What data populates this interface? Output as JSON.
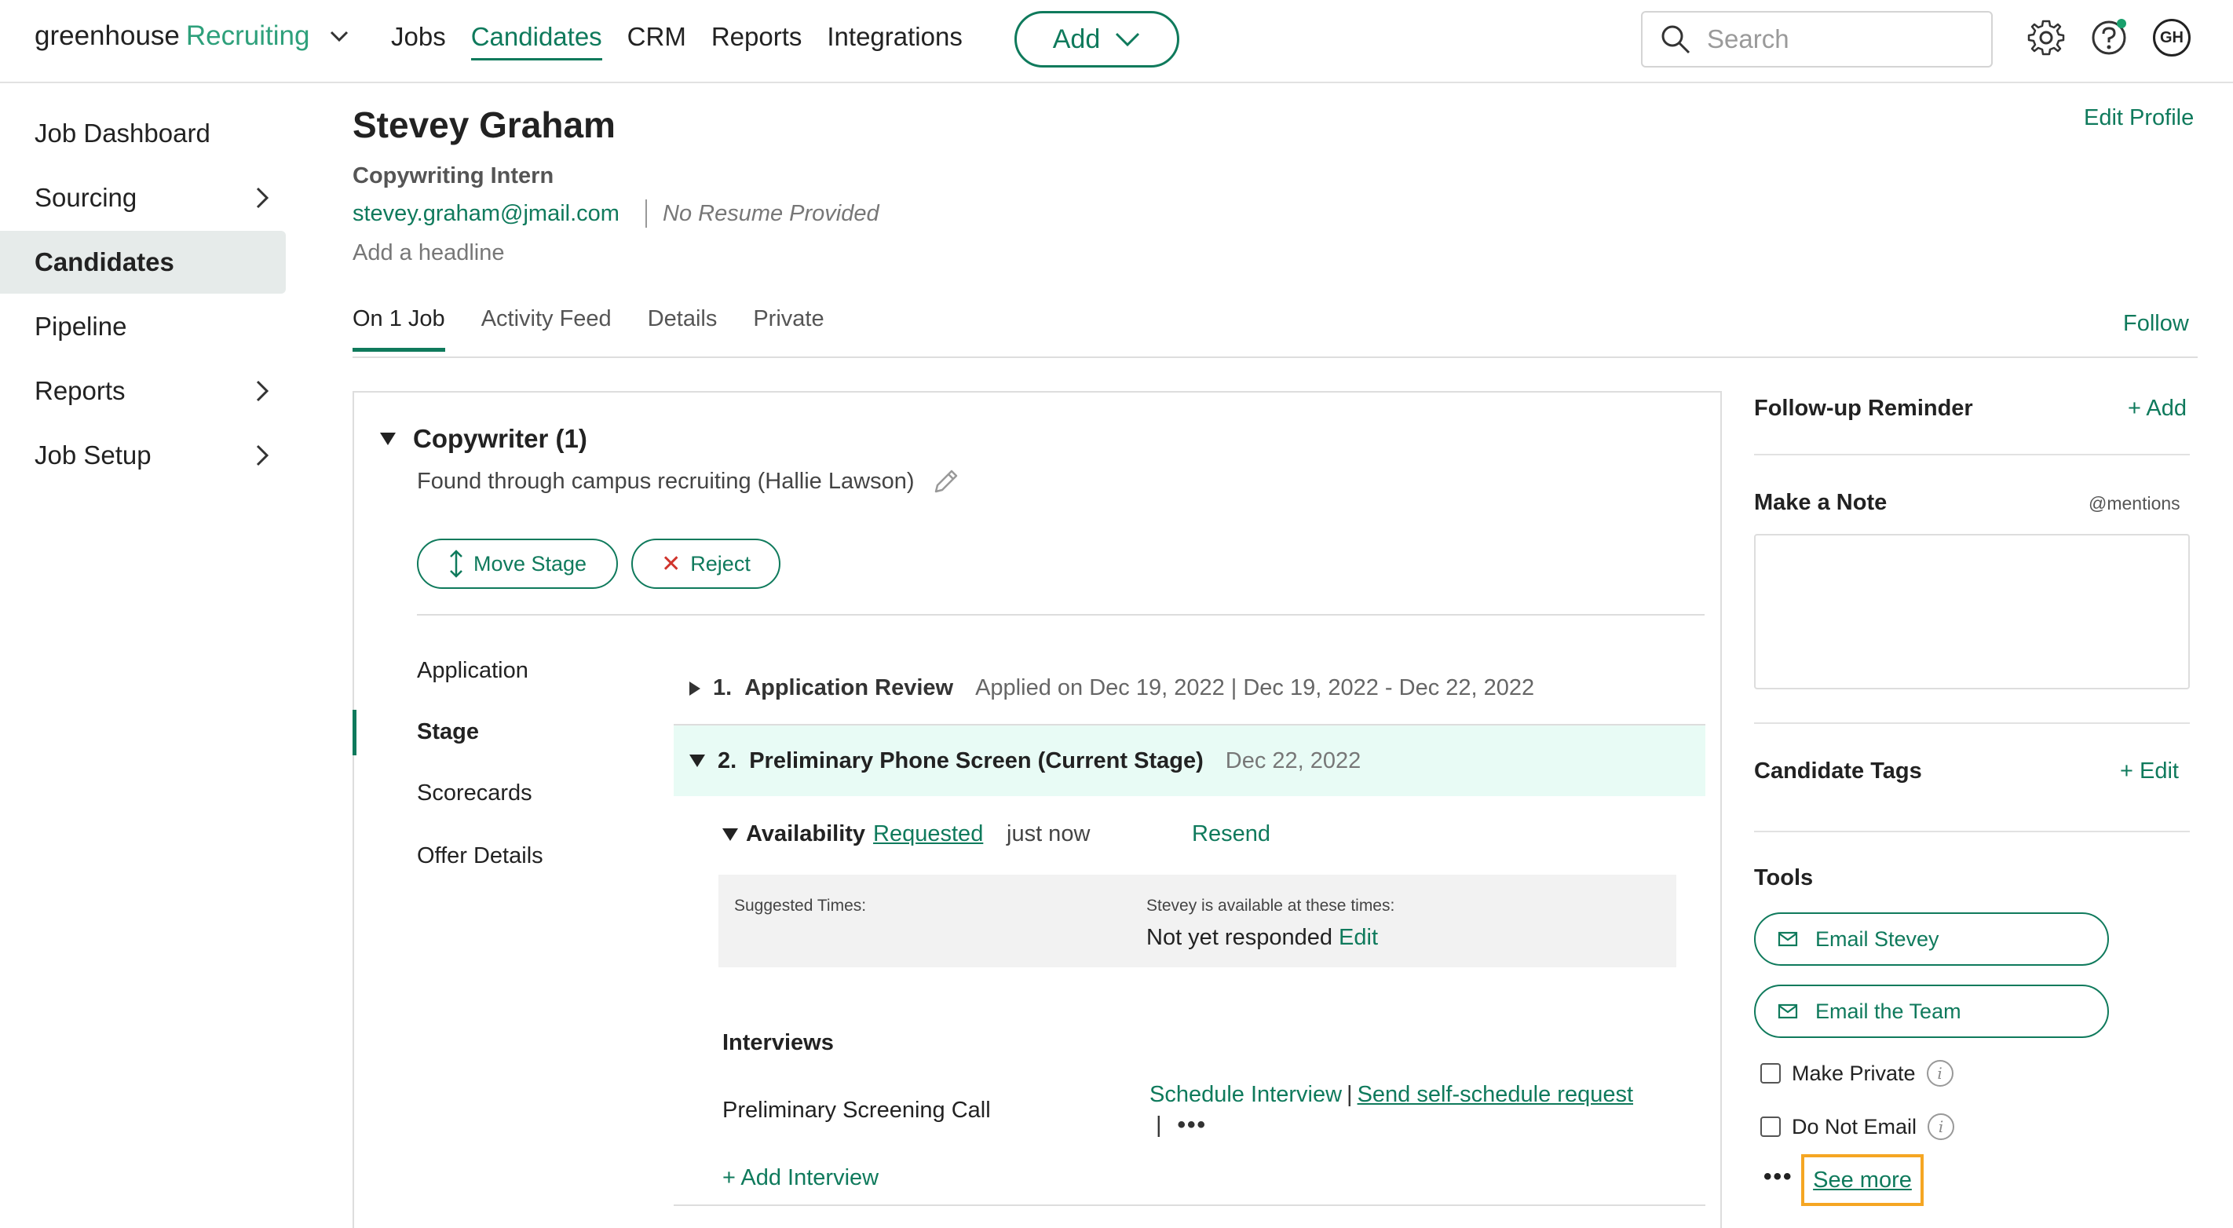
{
  "app": {
    "logo_main": "greenhouse",
    "logo_product": "Recruiting"
  },
  "nav": {
    "links": [
      "Jobs",
      "Candidates",
      "CRM",
      "Reports",
      "Integrations"
    ],
    "active": "Candidates",
    "add_label": "Add",
    "search_placeholder": "Search",
    "avatar_initials": "GH"
  },
  "sidebar": {
    "items": [
      {
        "label": "Job Dashboard",
        "has_chevron": false
      },
      {
        "label": "Sourcing",
        "has_chevron": true
      },
      {
        "label": "Candidates",
        "has_chevron": false,
        "active": true
      },
      {
        "label": "Pipeline",
        "has_chevron": false
      },
      {
        "label": "Reports",
        "has_chevron": true
      },
      {
        "label": "Job Setup",
        "has_chevron": true
      }
    ]
  },
  "candidate": {
    "name": "Stevey Graham",
    "title": "Copywriting Intern",
    "email": "stevey.graham@jmail.com",
    "resume_status": "No Resume Provided",
    "headline_placeholder": "Add a headline",
    "edit_profile_label": "Edit Profile"
  },
  "tabs": {
    "items": [
      "On 1 Job",
      "Activity Feed",
      "Details",
      "Private"
    ],
    "active": "On 1 Job",
    "follow_label": "Follow"
  },
  "job": {
    "title": "Copywriter (1)",
    "source": "Found through campus recruiting (Hallie Lawson)",
    "move_stage_label": "Move Stage",
    "reject_label": "Reject",
    "subnav": [
      "Application",
      "Stage",
      "Scorecards",
      "Offer Details"
    ],
    "subnav_active": "Stage",
    "stage1": {
      "number": "1.",
      "name": "Application Review",
      "meta": "Applied on Dec 19, 2022 | Dec 19, 2022 - Dec 22, 2022"
    },
    "stage2": {
      "number": "2.",
      "name": "Preliminary Phone Screen (Current Stage)",
      "meta": "Dec 22, 2022"
    },
    "availability": {
      "label": "Availability",
      "status": "Requested",
      "time": "just now",
      "resend_label": "Resend",
      "suggested_label": "Suggested Times:",
      "available_label": "Stevey is available at these times:",
      "response": "Not yet responded",
      "edit_label": "Edit"
    },
    "interviews": {
      "heading": "Interviews",
      "name": "Preliminary Screening Call",
      "schedule_label": "Schedule Interview",
      "separator": "|",
      "self_schedule_label": "Send self-schedule request",
      "more_label": "•••",
      "add_label": "+ Add Interview"
    }
  },
  "right_panel": {
    "followup_heading": "Follow-up Reminder",
    "followup_add": "+ Add",
    "note_heading": "Make a Note",
    "note_mentions": "@mentions",
    "tags_heading": "Candidate Tags",
    "tags_edit": "+ Edit",
    "tools_heading": "Tools",
    "email_candidate": "Email Stevey",
    "email_team": "Email the Team",
    "make_private": "Make Private",
    "do_not_email": "Do Not Email",
    "info_glyph": "i",
    "more_dots": "•••",
    "see_more": "See more"
  },
  "colors": {
    "accent": "#0f7a5c",
    "logo_green": "#2ea07b",
    "current_stage_bg": "#e8fbf5",
    "highlight": "#f5a623",
    "reject_x": "#d0342c"
  }
}
